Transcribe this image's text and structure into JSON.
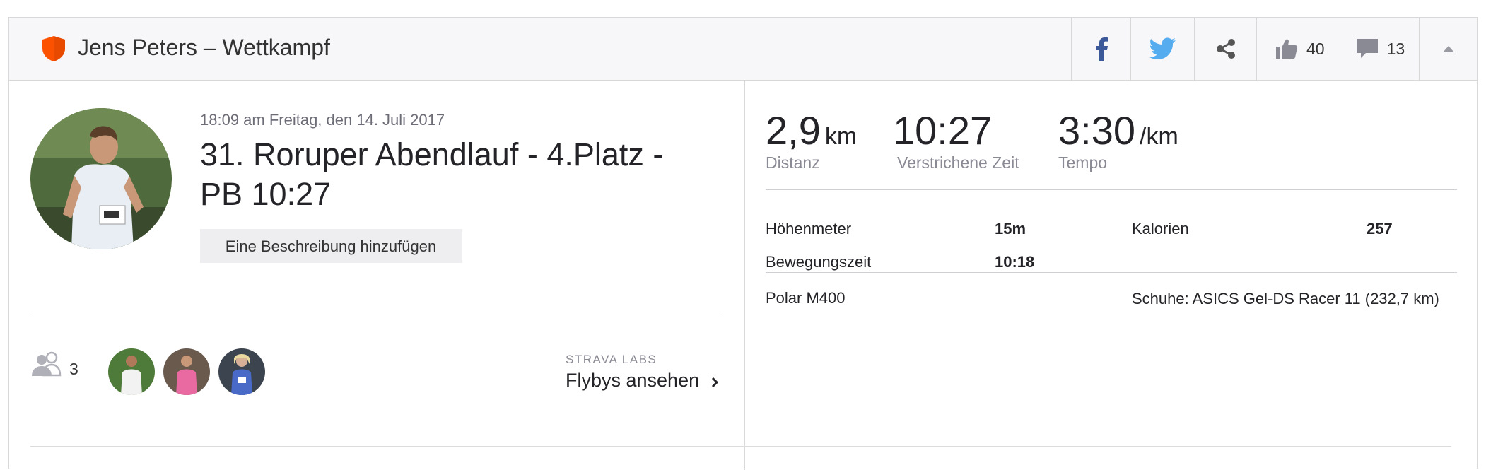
{
  "header": {
    "title": "Jens Peters – Wettkampf",
    "kudos_count": "40",
    "comment_count": "13"
  },
  "activity": {
    "date": "18:09 am Freitag, den 14. Juli 2017",
    "title": "31. Roruper Abendlauf - 4.Platz - PB 10:27",
    "description_button": "Eine Beschreibung hinzufügen"
  },
  "athletes": {
    "count": "3"
  },
  "flyby": {
    "tag": "STRAVA LABS",
    "link": "Flybys ansehen"
  },
  "stats": {
    "distance": {
      "value": "2,9",
      "unit": "km",
      "label": "Distanz"
    },
    "elapsed": {
      "value": "10:27",
      "label": "Verstrichene Zeit"
    },
    "pace": {
      "value": "3:30",
      "unit": "/km",
      "label": "Tempo"
    }
  },
  "details": {
    "elevation_label": "Höhenmeter",
    "elevation_value": "15m",
    "calories_label": "Kalorien",
    "calories_value": "257",
    "moving_label": "Bewegungszeit",
    "moving_value": "10:18"
  },
  "gear": {
    "device": "Polar M400",
    "shoes": "Schuhe: ASICS Gel-DS Racer 11 (232,7 km)"
  },
  "colors": {
    "brand_orange": "#fc5200",
    "facebook": "#3b5998",
    "twitter": "#55acee",
    "icon_gray": "#8a8a94"
  }
}
